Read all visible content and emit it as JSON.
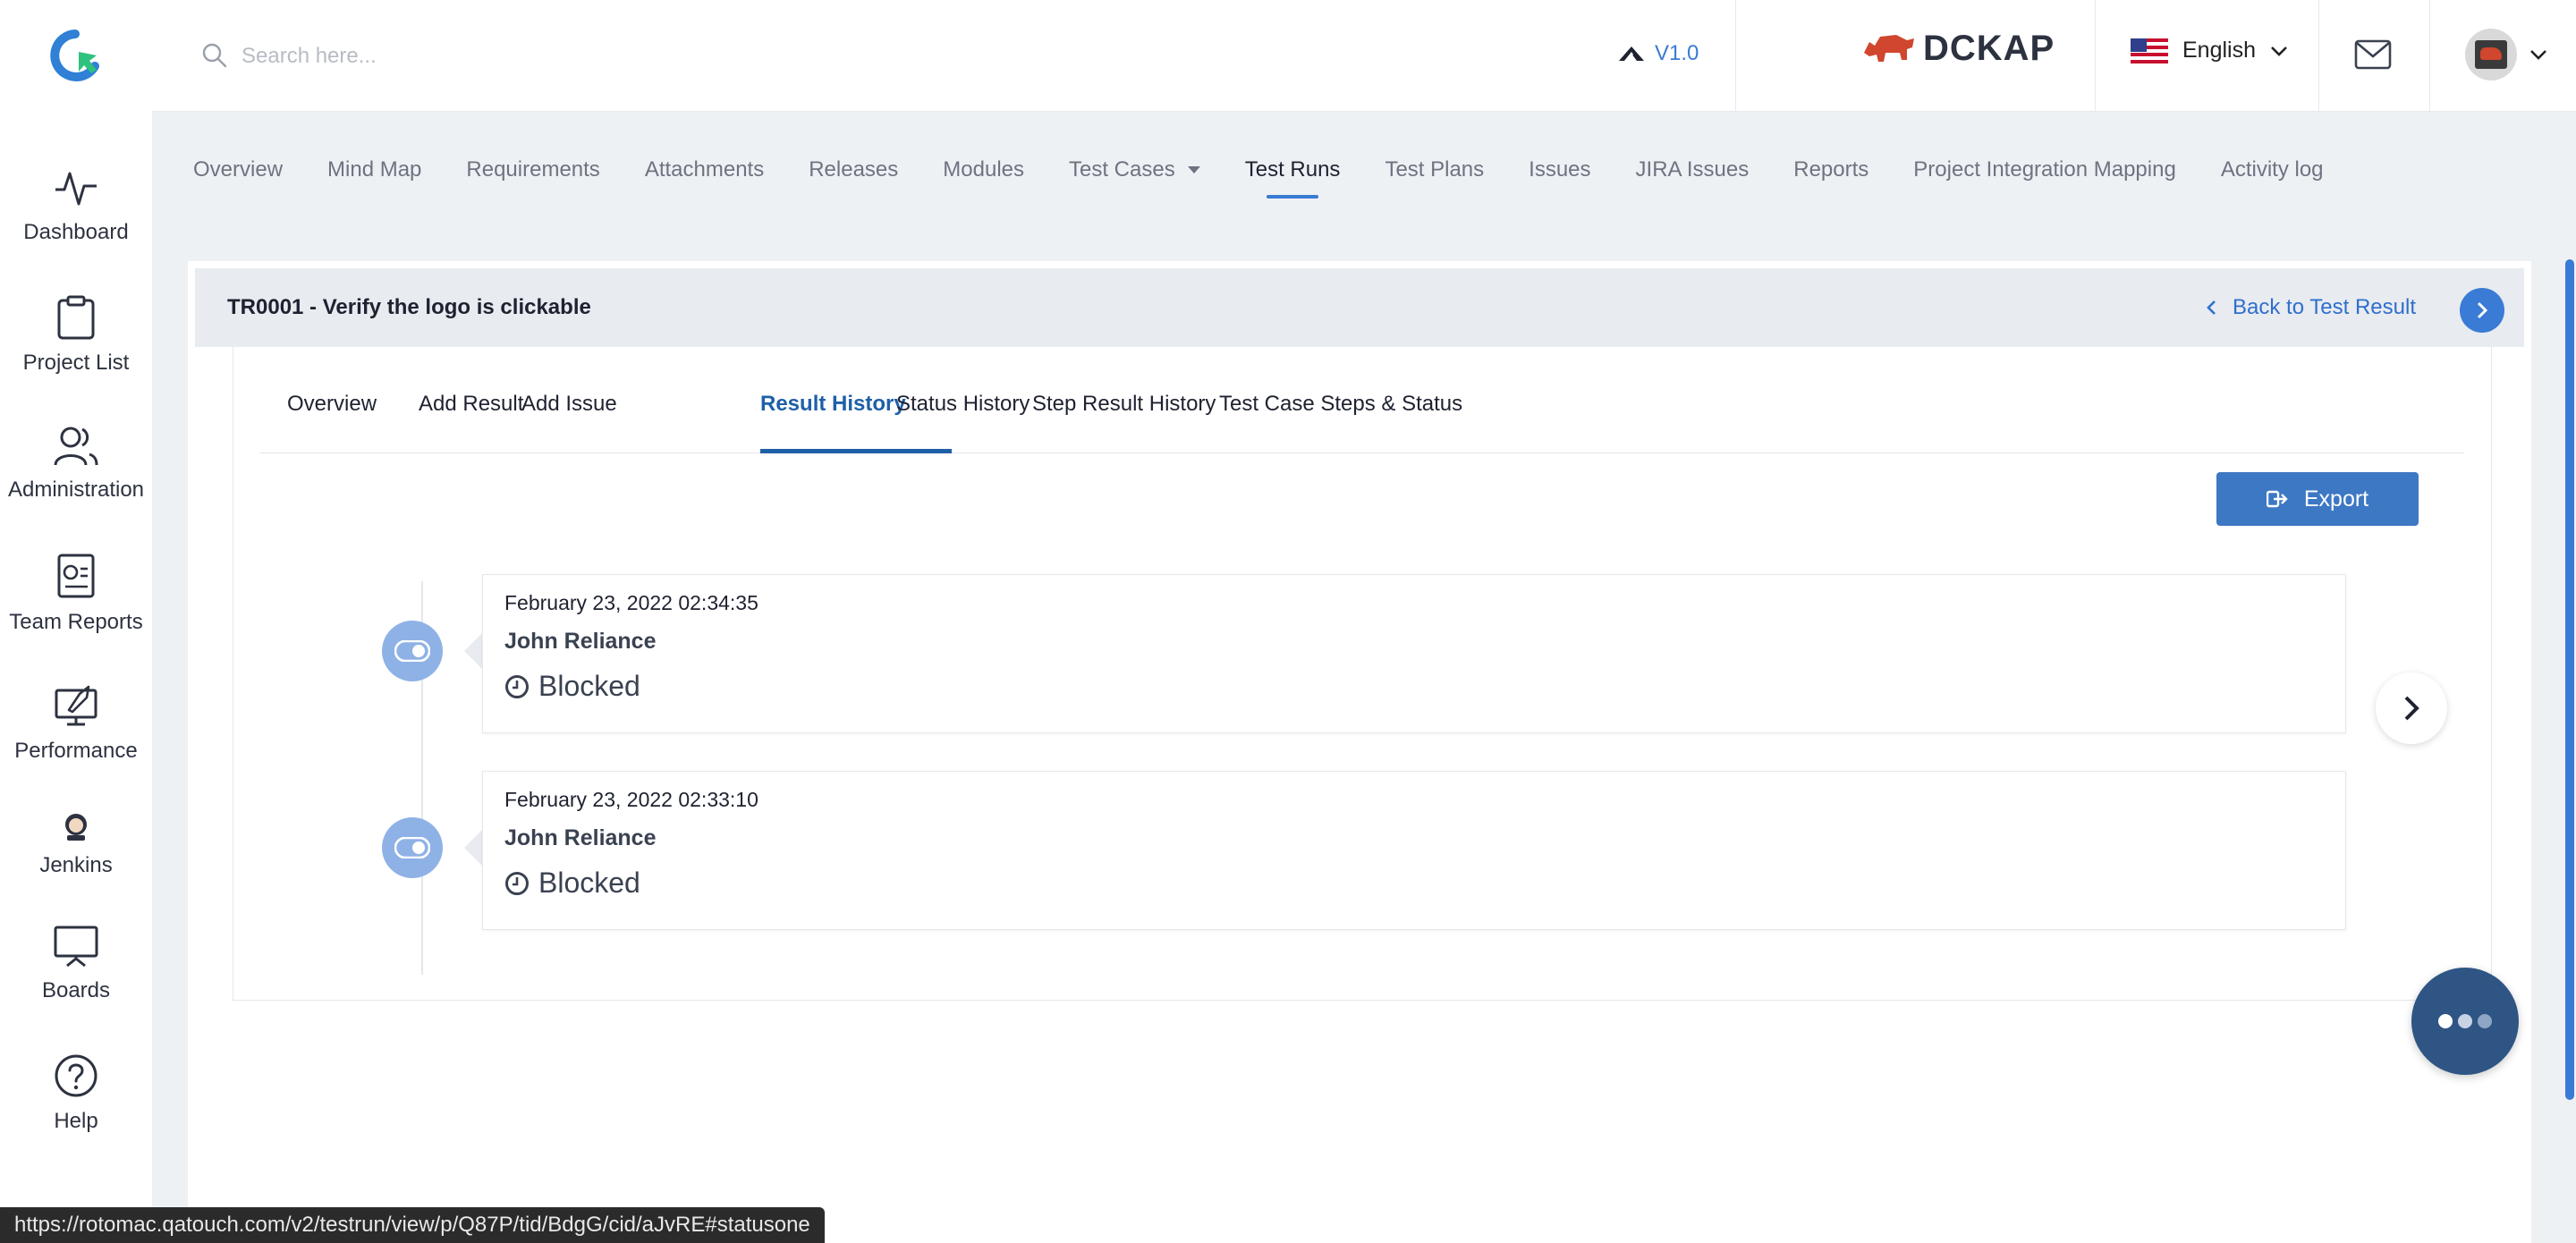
{
  "header": {
    "search_placeholder": "Search here...",
    "version": "V1.0",
    "brand": "DCKAP",
    "language": "English"
  },
  "sidebar": {
    "items": [
      {
        "label": "Dashboard",
        "icon": "activity-icon"
      },
      {
        "label": "Project List",
        "icon": "clipboard-icon"
      },
      {
        "label": "Administration",
        "icon": "users-icon"
      },
      {
        "label": "Team Reports",
        "icon": "report-icon"
      },
      {
        "label": "Performance",
        "icon": "performance-icon"
      },
      {
        "label": "Jenkins",
        "icon": "jenkins-icon"
      },
      {
        "label": "Boards",
        "icon": "board-icon"
      },
      {
        "label": "Help",
        "icon": "help-icon"
      }
    ]
  },
  "module_nav": {
    "items": [
      {
        "label": "Overview"
      },
      {
        "label": "Mind Map"
      },
      {
        "label": "Requirements"
      },
      {
        "label": "Attachments"
      },
      {
        "label": "Releases"
      },
      {
        "label": "Modules"
      },
      {
        "label": "Test Cases"
      },
      {
        "label": "Test Runs"
      },
      {
        "label": "Test Plans"
      },
      {
        "label": "Issues"
      },
      {
        "label": "JIRA Issues"
      },
      {
        "label": "Reports"
      },
      {
        "label": "Project Integration Mapping"
      },
      {
        "label": "Activity log"
      }
    ],
    "active": "Test Runs"
  },
  "test_run": {
    "title": "TR0001 - Verify the logo is clickable",
    "back_label": "Back to Test Result"
  },
  "tabs": {
    "items": [
      {
        "label": "Overview"
      },
      {
        "label": "Add Result"
      },
      {
        "label": "Add Issue"
      },
      {
        "label": "Result History"
      },
      {
        "label": "Status History"
      },
      {
        "label": "Step Result History"
      },
      {
        "label": "Test Case Steps & Status"
      }
    ],
    "active": "Result History"
  },
  "export_label": "Export",
  "history": [
    {
      "date": "February 23, 2022 02:34:35",
      "user": "John Reliance",
      "status": "Blocked"
    },
    {
      "date": "February 23, 2022 02:33:10",
      "user": "John Reliance",
      "status": "Blocked"
    }
  ],
  "status_url": "https://rotomac.qatouch.com/v2/testrun/view/p/Q87P/tid/BdgG/cid/aJvRE#statusone",
  "colors": {
    "accent": "#3a7bd5",
    "active_tab": "#1f5fa8",
    "timeline_dot": "#8fb2e6",
    "chat": "#2f5585",
    "brand": "#d0462e"
  }
}
